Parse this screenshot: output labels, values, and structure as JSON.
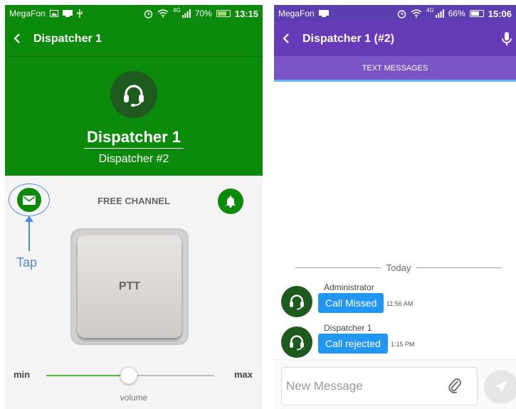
{
  "left": {
    "status": {
      "carrier": "MegaFon",
      "battery": "70%",
      "time": "13:15",
      "signal": "4G"
    },
    "toolbar": {
      "back_icon": "chevron-left-icon",
      "title": "Dispatcher 1"
    },
    "hero": {
      "name": "Dispatcher 1",
      "subtitle": "Dispatcher #2",
      "avatar_icon": "headset-icon"
    },
    "channel_label": "FREE CHANNEL",
    "annotation": {
      "text": "Tap",
      "color": "#4f8ad8"
    },
    "ptt_label": "PTT",
    "volume": {
      "min_label": "min",
      "max_label": "max",
      "caption": "volume",
      "level": 0.49
    },
    "colors": {
      "primary": "#0b8a0b",
      "avatar": "#1f5a1f"
    },
    "icons": {
      "mail": "envelope-icon",
      "bell": "bell-icon"
    }
  },
  "right": {
    "status": {
      "carrier": "MegaFon",
      "battery": "66%",
      "time": "15:06",
      "signal": "4G"
    },
    "toolbar": {
      "back_icon": "chevron-left-icon",
      "title": "Dispatcher 1 (#2)",
      "mic_icon": "microphone-icon"
    },
    "tab": {
      "label": "TEXT MESSAGES"
    },
    "date_separator": "Today",
    "messages": [
      {
        "sender": "Administrator",
        "text": "Call Missed",
        "time": "11:56 AM"
      },
      {
        "sender": "Dispatcher 1",
        "text": "Call rejected",
        "time": "1:15 PM"
      }
    ],
    "composer": {
      "placeholder": "New Message",
      "attach_icon": "paperclip-icon",
      "send_icon": "send-icon"
    },
    "colors": {
      "primary": "#673ab7",
      "bubble": "#2196f3",
      "tab_indicator": "#64b5f6"
    }
  }
}
